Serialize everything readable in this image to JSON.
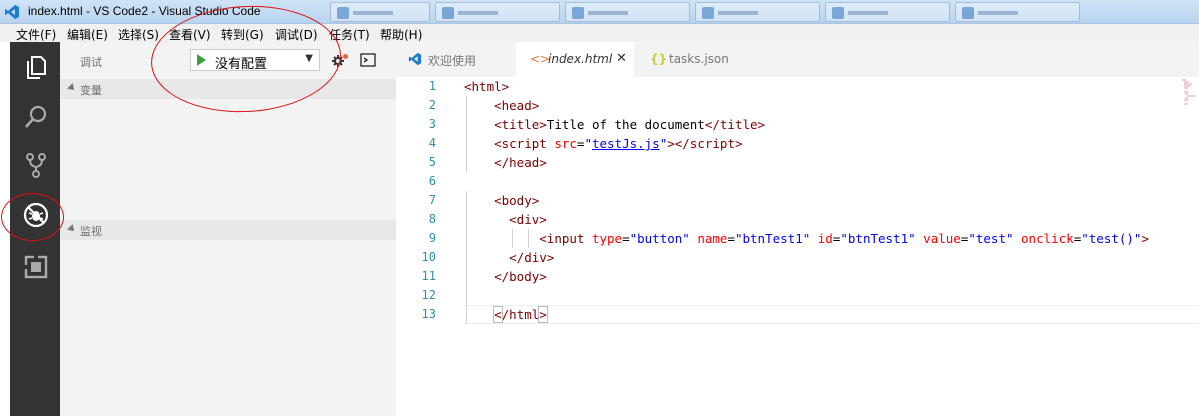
{
  "window": {
    "title": "index.html - VS Code2 - Visual Studio Code"
  },
  "menu": [
    "文件(F)",
    "编辑(E)",
    "选择(S)",
    "查看(V)",
    "转到(G)",
    "调试(D)",
    "任务(T)",
    "帮助(H)"
  ],
  "activity_bar": [
    {
      "icon": "files-icon"
    },
    {
      "icon": "search-icon"
    },
    {
      "icon": "source-control-icon"
    },
    {
      "icon": "debug-icon",
      "active": true
    },
    {
      "icon": "extensions-icon"
    }
  ],
  "debug": {
    "title": "调试",
    "config": "没有配置",
    "sections": {
      "variables": "变量",
      "watch": "监视"
    }
  },
  "tabs": [
    {
      "label": "欢迎使用",
      "icon": "vscode-icon",
      "active": false
    },
    {
      "label": "index.html",
      "icon": "html-icon",
      "active": true,
      "close": "✕"
    },
    {
      "label": "tasks.json",
      "icon": "json-icon",
      "active": false
    }
  ],
  "editor": {
    "line_numbers": [
      "1",
      "2",
      "3",
      "4",
      "5",
      "6",
      "7",
      "8",
      "9",
      "10",
      "11",
      "12",
      "13"
    ]
  },
  "colors": {
    "tag": "#800000",
    "attribute": "#ff0000",
    "value": "#0000ff",
    "line_number": "#2b91af",
    "activity_bar": "#333333",
    "annotation": "#e01010"
  }
}
